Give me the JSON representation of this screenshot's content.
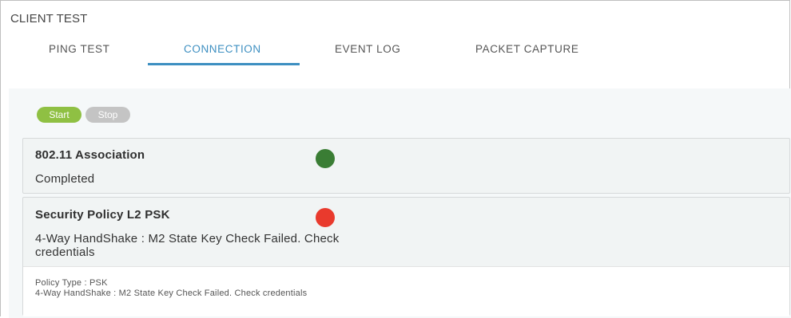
{
  "app": {
    "title": "CLIENT TEST"
  },
  "tabs": [
    {
      "label": "PING TEST"
    },
    {
      "label": "CONNECTION",
      "active": true
    },
    {
      "label": "EVENT LOG"
    },
    {
      "label": "PACKET CAPTURE"
    }
  ],
  "controls": {
    "start_label": "Start",
    "stop_label": "Stop"
  },
  "colors": {
    "accent": "#3d8fc1",
    "start": "#8fc043",
    "stop": "#c4c4c4",
    "status_ok": "#3a7d34",
    "status_fail": "#e93a2d"
  },
  "steps": [
    {
      "title": "802.11 Association",
      "status_text": "Completed",
      "status": "ok"
    },
    {
      "title": "Security Policy L2 PSK",
      "status_text_line1": "4-Way HandShake : M2 State Key Check Failed. Check",
      "status_text_line2": "credentials",
      "status": "fail",
      "details": {
        "policy_type": "Policy Type : PSK",
        "handshake": "4-Way HandShake : M2 State Key Check Failed. Check credentials"
      }
    }
  ]
}
